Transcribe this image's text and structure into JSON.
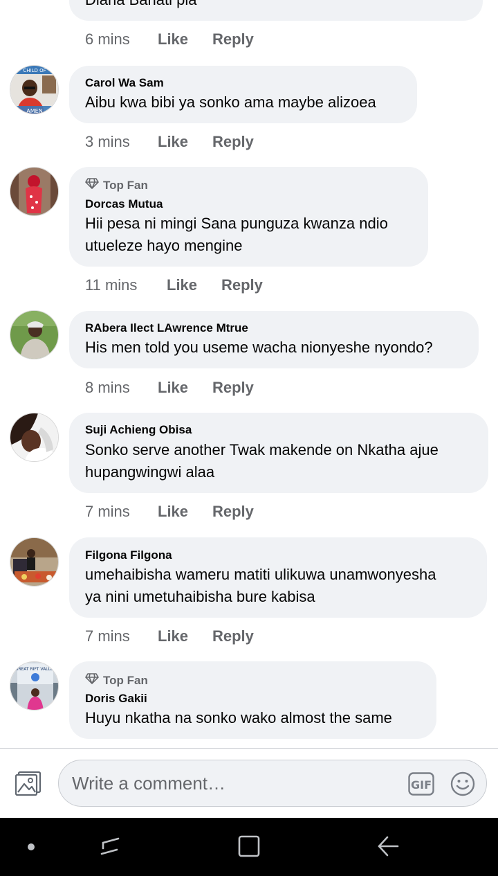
{
  "comments": [
    {
      "name": "",
      "top_fan": false,
      "lines": [
        "Diana Banati pia"
      ],
      "time": "6 mins",
      "like": "Like",
      "reply": "Reply"
    },
    {
      "name": "Carol Wa Sam",
      "top_fan": false,
      "lines": [
        "Aibu kwa bibi ya sonko ama maybe alizoea"
      ],
      "time": "3 mins",
      "like": "Like",
      "reply": "Reply",
      "avatar_text_top": "CHILD OF",
      "avatar_text_bottom": "AMEN"
    },
    {
      "name": "Dorcas Mutua",
      "top_fan": true,
      "top_fan_label": "Top Fan",
      "lines": [
        "Hii pesa ni mingi Sana punguza kwanza ndio",
        "utueleze hayo mengine"
      ],
      "time": "11 mins",
      "like": "Like",
      "reply": "Reply"
    },
    {
      "name": "RAbera Ilect LAwrence Mtrue",
      "top_fan": false,
      "lines": [
        "His men told you useme wacha nionyeshe nyondo?"
      ],
      "time": "8 mins",
      "like": "Like",
      "reply": "Reply"
    },
    {
      "name": "Suji Achieng Obisa",
      "top_fan": false,
      "lines": [
        "Sonko serve another Twak makende  on Nkatha ajue",
        "hupangwingwi alaa"
      ],
      "time": "7 mins",
      "like": "Like",
      "reply": "Reply"
    },
    {
      "name": "Filgona Filgona",
      "top_fan": false,
      "lines": [
        "umehaibisha wameru matiti ulikuwa unamwonyesha",
        "ya nini umetuhaibisha bure kabisa"
      ],
      "time": "7 mins",
      "like": "Like",
      "reply": "Reply"
    },
    {
      "name": "Doris Gakii",
      "top_fan": true,
      "top_fan_label": "Top Fan",
      "lines": [
        "Huyu nkatha na sonko wako almost the same"
      ],
      "time": "",
      "like": "",
      "reply": "",
      "avatar_text_top": "GREAT RIFT VALLEY"
    }
  ],
  "composer": {
    "placeholder": "Write a comment…",
    "gif_label": "GIF"
  },
  "icons": {
    "photo": "photo-icon",
    "gif": "gif-icon",
    "emoji": "emoji-icon",
    "diamond": "diamond-icon",
    "recents": "recents-icon",
    "home": "home-icon",
    "back": "back-icon",
    "dot": "dot-icon"
  },
  "colors": {
    "bubble": "#f0f2f5",
    "meta_text": "#65676b",
    "nav_bar": "#000000"
  }
}
